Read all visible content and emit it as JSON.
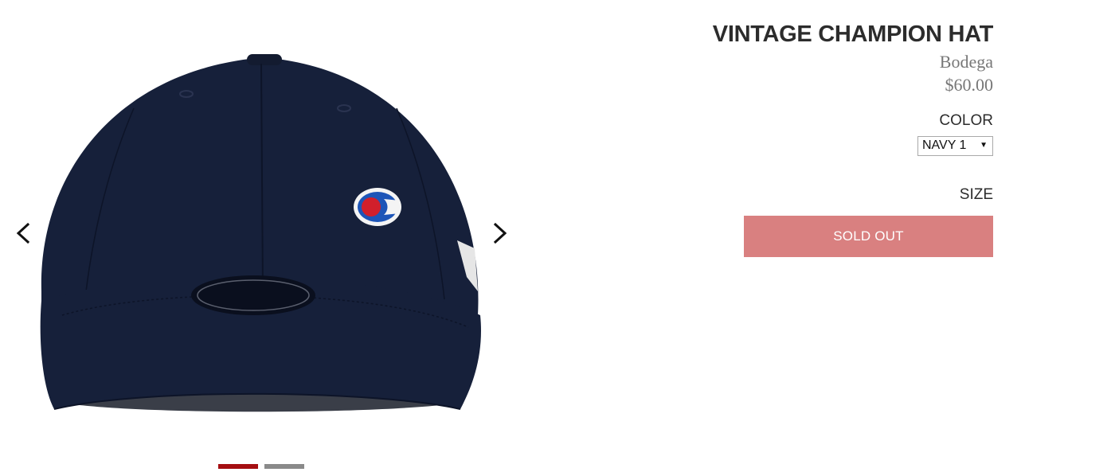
{
  "product": {
    "title": "VINTAGE CHAMPION HAT",
    "vendor": "Bodega",
    "price": "$60.00"
  },
  "options": {
    "color_label": "COLOR",
    "color_selected": "NAVY 1",
    "size_label": "SIZE"
  },
  "actions": {
    "sold_out_label": "SOLD OUT"
  },
  "gallery": {
    "prev_icon": "chevron-left-icon",
    "next_icon": "chevron-right-icon",
    "slide_count": 2,
    "active_slide": 1
  },
  "colors": {
    "cap_navy": "#16203a",
    "accent_red": "#a50f12",
    "sold_out_bg": "#d98080",
    "dot_inactive": "#8a8a8a"
  }
}
